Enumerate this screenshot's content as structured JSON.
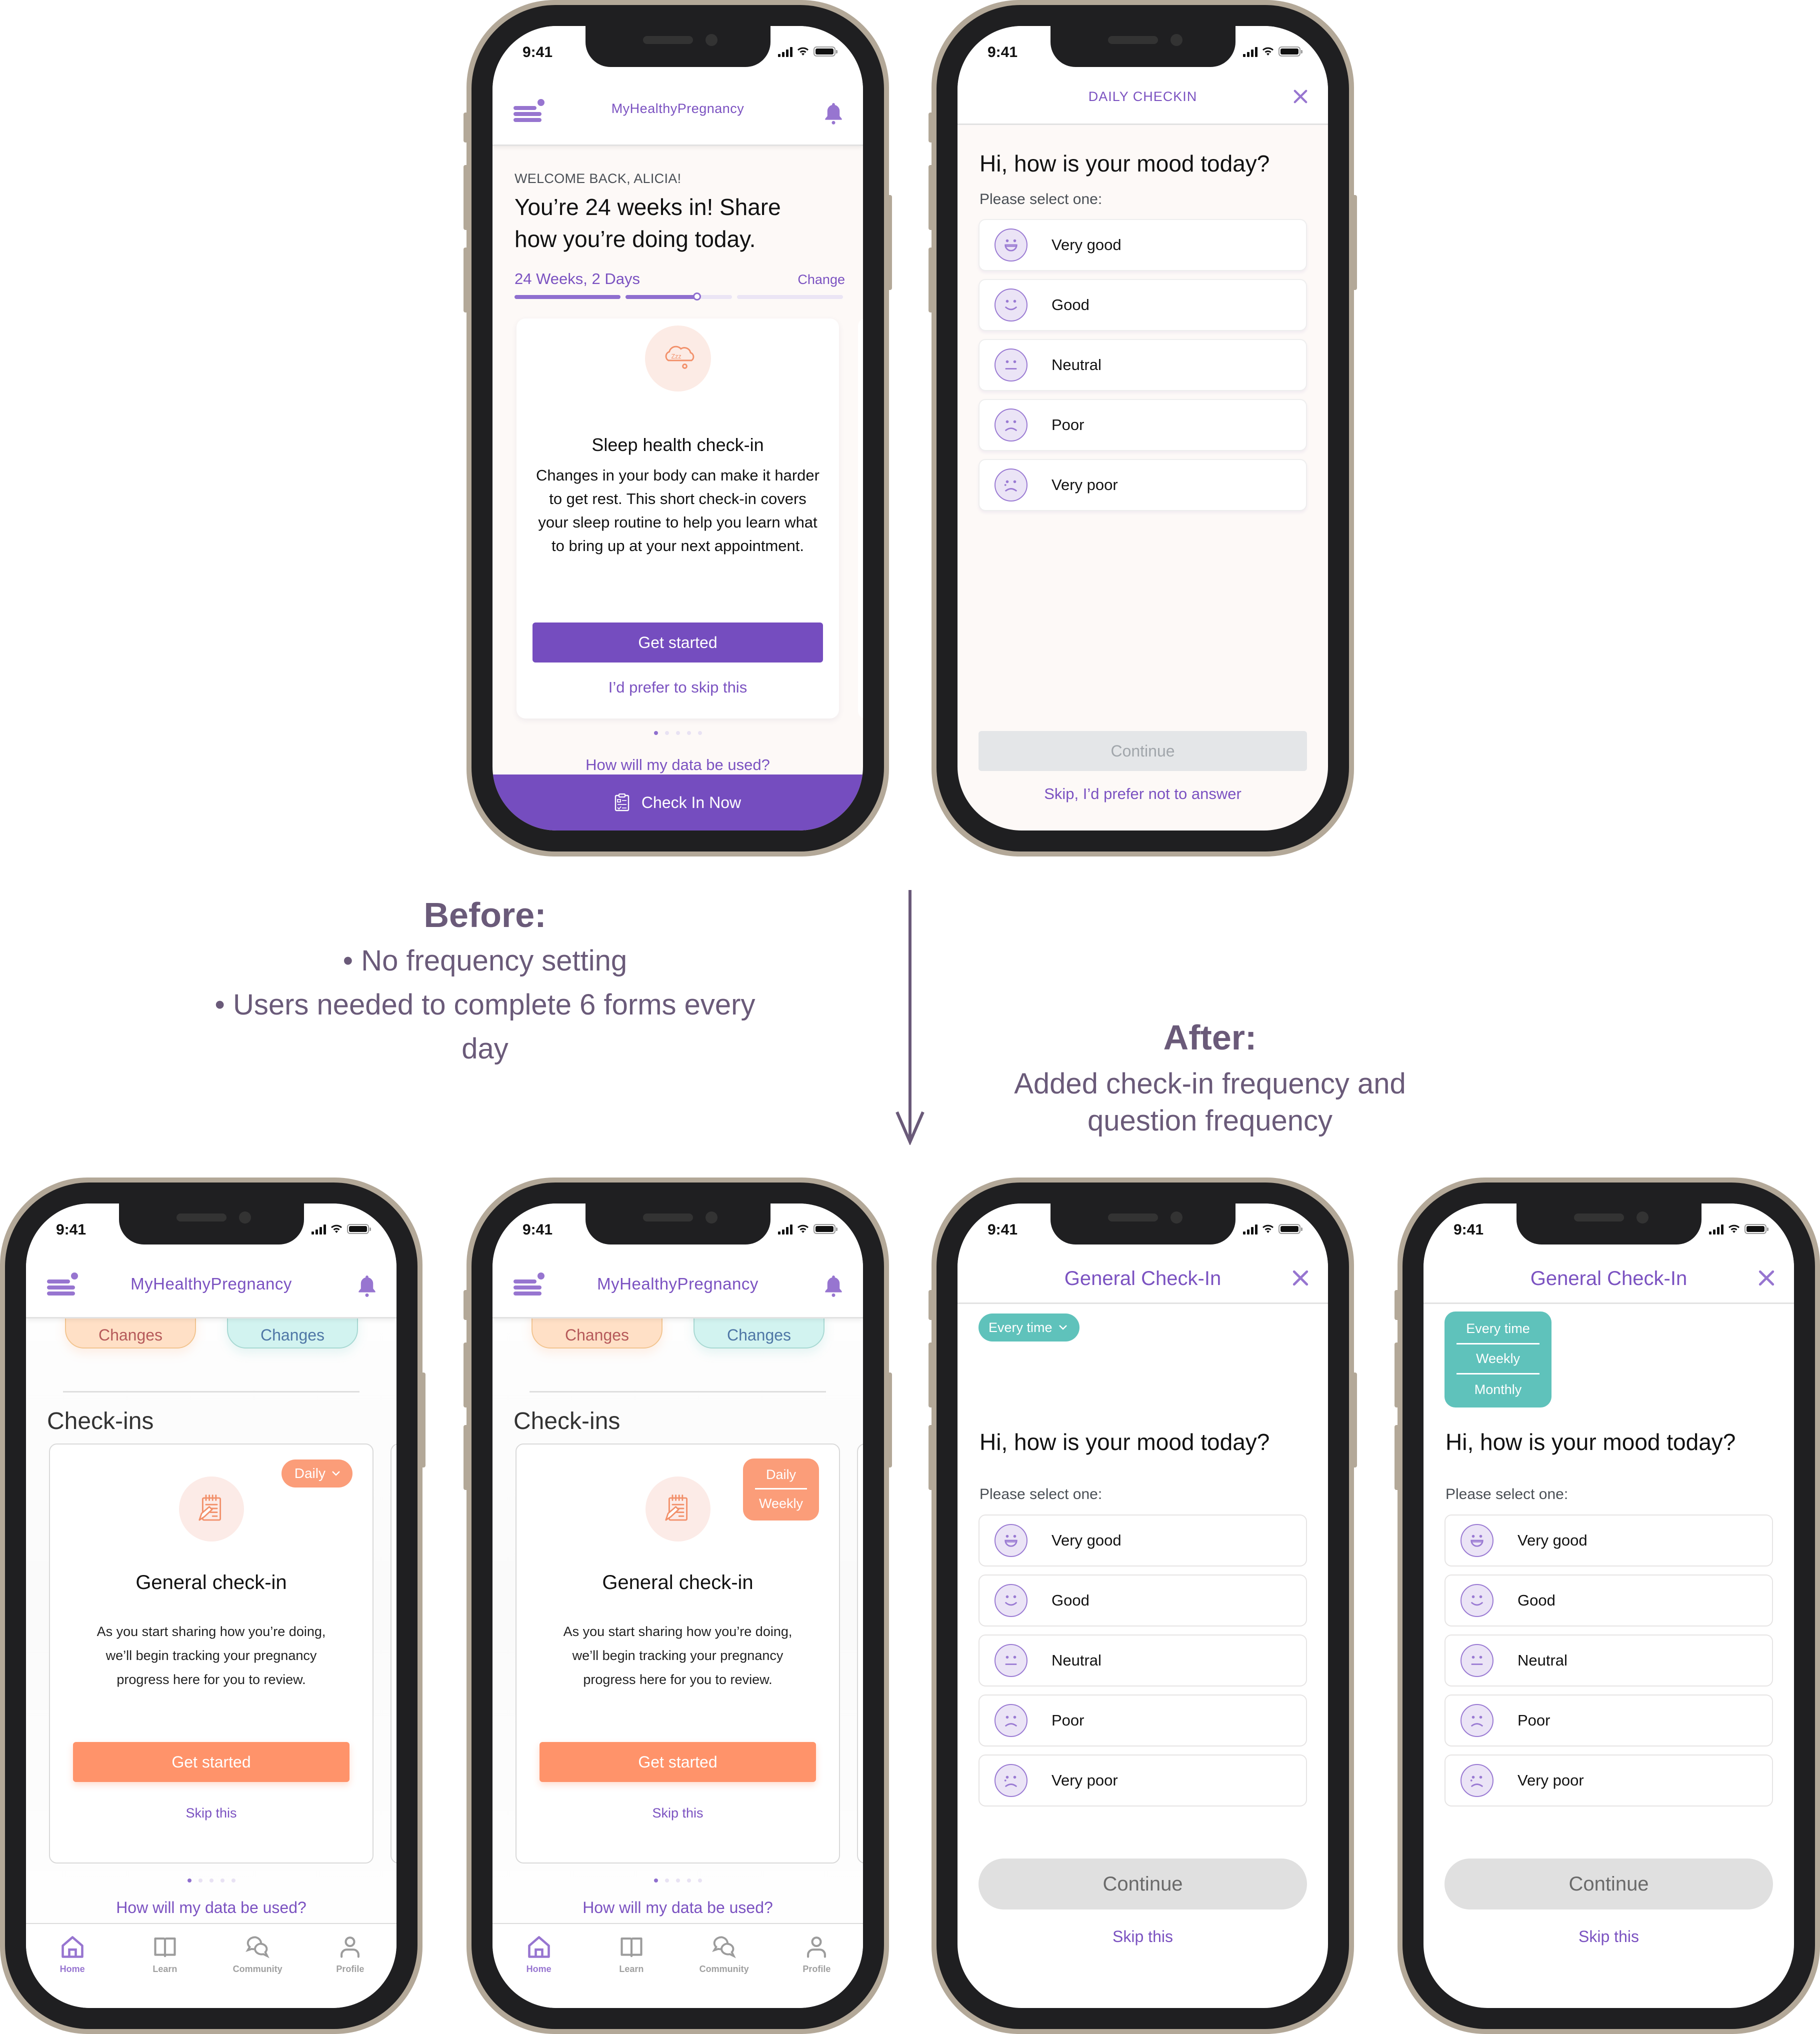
{
  "colors": {
    "brand_purple": "#7b52c1",
    "light_purple": "#9775d0",
    "orange": "#ff936a",
    "teal": "#5fc2bb",
    "frame": "#b3a898",
    "annotation": "#6a5a79"
  },
  "status_bar": {
    "time": "9:41"
  },
  "annotations": {
    "before_title": "Before:",
    "before_bullets": [
      "No frequency setting",
      "Users needed to complete 6 forms every day"
    ],
    "after_title": "After:",
    "after_text_line1": "Added check-in frequency and",
    "after_text_line2": "question frequency"
  },
  "before_home": {
    "app_title": "MyHealthyPregnancy",
    "welcome": "WELCOME BACK, ALICIA!",
    "headline_line1": "You’re 24 weeks in! Share",
    "headline_line2": "how you’re doing today.",
    "week_label": "24 Weeks, 2 Days",
    "change_link": "Change",
    "pregnancy_progress_segments": [
      1.0,
      0.67,
      0.0
    ],
    "card": {
      "icon": "sleep-cloud-icon",
      "title": "Sleep health check-in",
      "body": "Changes in your body can make it harder to get rest. This short check-in covers your sleep routine to help you learn what to bring up at your next appointment.",
      "primary_button": "Get started",
      "skip_link": "I’d prefer to skip this"
    },
    "carousel": {
      "total": 5,
      "active": 1
    },
    "data_link": "How will my data be used?",
    "bottom_button": "Check In Now"
  },
  "before_checkin": {
    "header_title": "DAILY CHECKIN",
    "progress": 0.08,
    "question": "Hi, how is your mood today?",
    "instruction": "Please select one:",
    "options": [
      "Very good",
      "Good",
      "Neutral",
      "Poor",
      "Very poor"
    ],
    "continue_button": "Continue",
    "skip_link": "Skip, I’d prefer not to answer"
  },
  "after_home": {
    "app_title": "MyHealthyPregnancy",
    "chip_left": "Changes",
    "chip_right": "Changes",
    "section_title": "Check-ins",
    "card": {
      "icon": "notepad-icon",
      "title": "General check-in",
      "body_line1": "As you start sharing how you’re doing,",
      "body_line2": "we’ll begin tracking your pregnancy",
      "body_line3": "progress here for you to review.",
      "primary_button": "Get started",
      "skip_link": "Skip this"
    },
    "frequency_selected": "Daily",
    "frequency_options": [
      "Daily",
      "Weekly"
    ],
    "carousel": {
      "total": 5,
      "active": 1
    },
    "data_link": "How will my data be used?",
    "tabs": [
      {
        "label": "Home",
        "icon": "home-icon",
        "active": true
      },
      {
        "label": "Learn",
        "icon": "book-icon",
        "active": false
      },
      {
        "label": "Community",
        "icon": "chat-bubbles-icon",
        "active": false
      },
      {
        "label": "Profile",
        "icon": "person-icon",
        "active": false
      }
    ]
  },
  "after_checkin": {
    "header_title": "General Check-In",
    "progress": 0.08,
    "frequency_selected": "Every time",
    "frequency_options": [
      "Every time",
      "Weekly",
      "Monthly"
    ],
    "question": "Hi, how is your mood today?",
    "instruction": "Please select one:",
    "options": [
      "Very good",
      "Good",
      "Neutral",
      "Poor",
      "Very poor"
    ],
    "continue_button": "Continue",
    "skip_link": "Skip this"
  }
}
